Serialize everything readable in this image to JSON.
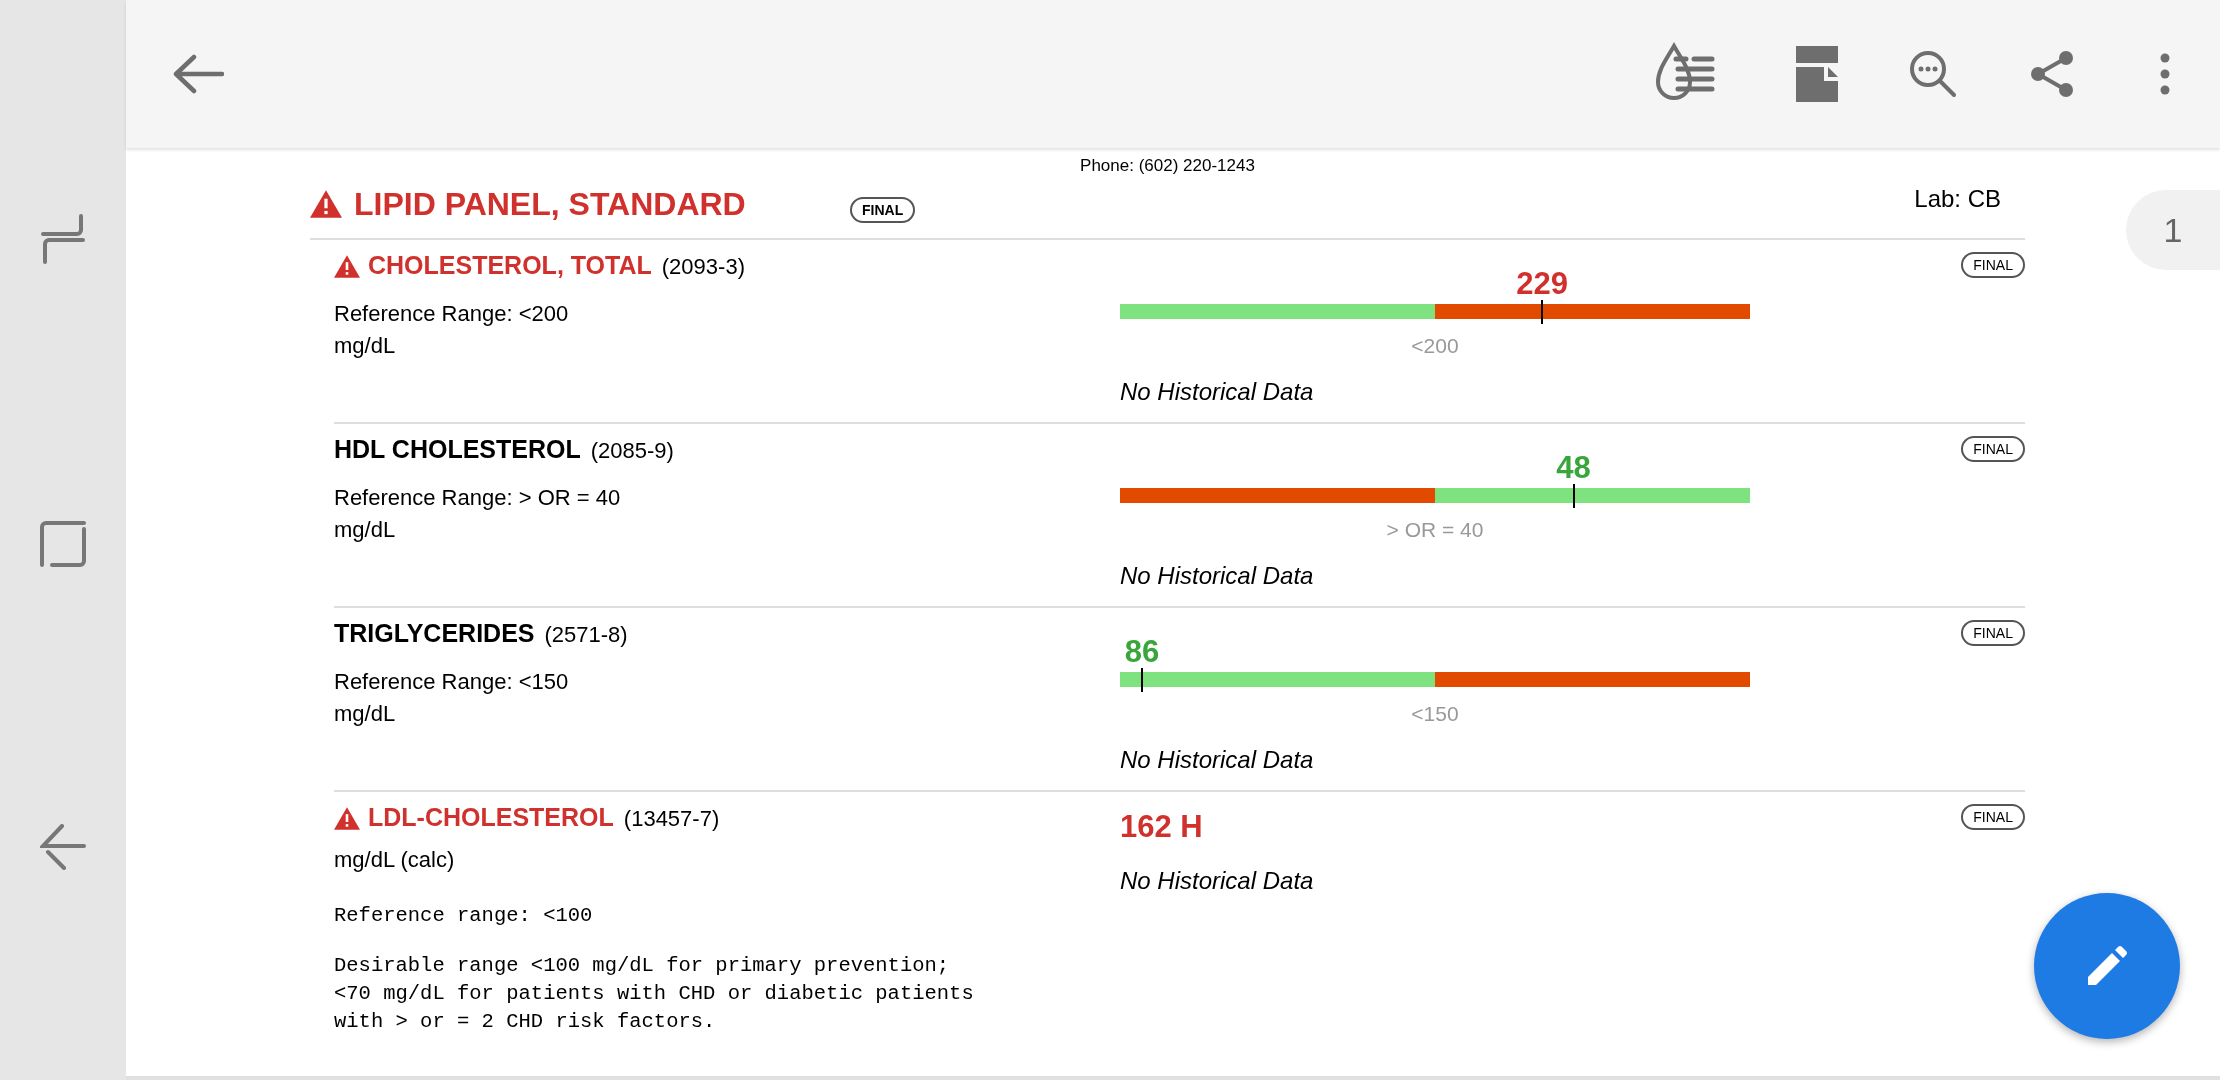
{
  "header": {
    "phone": "Phone: (602) 220-1243",
    "title": "LIPID PANEL, STANDARD",
    "flagged": true,
    "status": "FINAL",
    "lab": "Lab: CB"
  },
  "page_indicator": "1",
  "results": [
    {
      "kind": "gauge",
      "flagged": true,
      "name": "CHOLESTEROL, TOTAL",
      "code": "(2093-3)",
      "reference": "Reference Range: <200",
      "unit": "mg/dL",
      "status": "FINAL",
      "value": "229",
      "value_normal": false,
      "level": 0.67,
      "segments": [
        {
          "kind": "normal"
        },
        {
          "kind": "abnormal"
        }
      ],
      "range_label": "<200",
      "history": "No Historical Data"
    },
    {
      "kind": "gauge",
      "flagged": false,
      "name": "HDL CHOLESTEROL",
      "code": "(2085-9)",
      "reference": "Reference Range: > OR = 40",
      "unit": "mg/dL",
      "status": "FINAL",
      "value": "48",
      "value_normal": true,
      "level": 0.72,
      "segments": [
        {
          "kind": "abnormal"
        },
        {
          "kind": "normal"
        }
      ],
      "range_label": "> OR = 40",
      "history": "No Historical Data"
    },
    {
      "kind": "gauge",
      "flagged": false,
      "name": "TRIGLYCERIDES",
      "code": "(2571-8)",
      "reference": "Reference Range: <150",
      "unit": "mg/dL",
      "status": "FINAL",
      "value": "86",
      "value_normal": true,
      "level": 0.035,
      "segments": [
        {
          "kind": "normal"
        },
        {
          "kind": "abnormal"
        }
      ],
      "range_label": "<150",
      "history": "No Historical Data"
    },
    {
      "kind": "text",
      "flagged": true,
      "name": "LDL-CHOLESTEROL",
      "code": "(13457-7)",
      "unit": "mg/dL (calc)",
      "status": "FINAL",
      "value": "162 H",
      "value_normal": false,
      "history": "No Historical Data",
      "notes": [
        "Reference range: <100",
        "Desirable range <100 mg/dL for primary prevention;\n<70 mg/dL for patients with CHD or diabetic patients\nwith > or = 2 CHD risk factors."
      ]
    }
  ]
}
